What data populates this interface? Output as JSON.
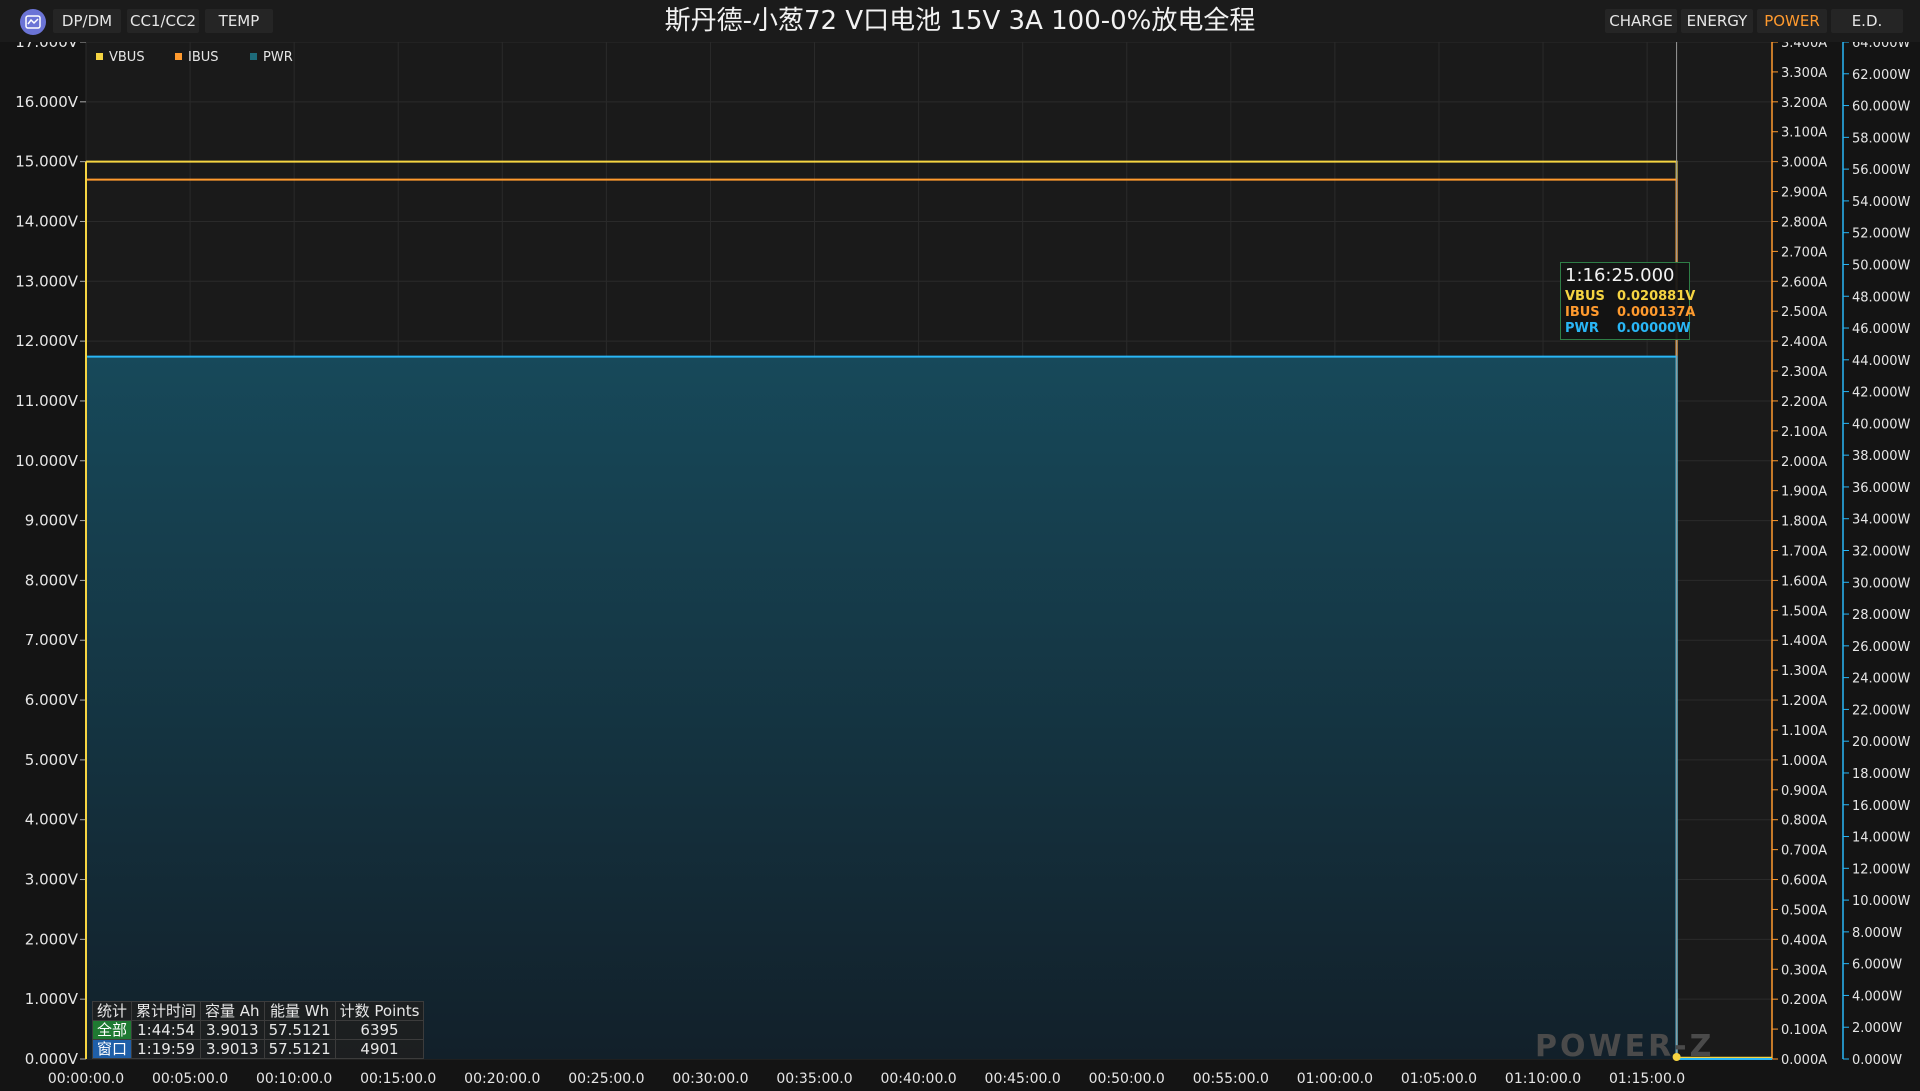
{
  "window": {
    "title": "斯丹德-小葱72 V口电池 15V 3A 100-0%放电全程"
  },
  "toolbar": {
    "left_tabs": [
      "DP/DM",
      "CC1/CC2",
      "TEMP"
    ],
    "mode_buttons": [
      {
        "label": "CHARGE",
        "active": false
      },
      {
        "label": "ENERGY",
        "active": false
      },
      {
        "label": "POWER",
        "active": true
      },
      {
        "label": "E.D.",
        "active": false
      }
    ]
  },
  "legend": [
    {
      "name": "VBUS",
      "color": "#f5d442"
    },
    {
      "name": "IBUS",
      "color": "#ff9a2e"
    },
    {
      "name": "PWR",
      "color": "#1e6b7a"
    }
  ],
  "tooltip": {
    "time": "1:16:25.000",
    "rows": [
      {
        "label": "VBUS",
        "value": "0.020881V",
        "color": "#f5d442"
      },
      {
        "label": "IBUS",
        "value": "0.000137A",
        "color": "#ff9a2e"
      },
      {
        "label": "PWR",
        "value": "0.00000W",
        "color": "#29b6f6"
      }
    ]
  },
  "stats": {
    "headers": [
      "统计",
      "累计时间",
      "容量 Ah",
      "能量 Wh",
      "计数 Points"
    ],
    "rows": [
      [
        "全部",
        "1:44:54",
        "3.9013",
        "57.5121",
        "6395"
      ],
      [
        "窗口",
        "1:19:59",
        "3.9013",
        "57.5121",
        "4901"
      ]
    ]
  },
  "logo_text": "POWER-Z",
  "colors": {
    "vbus": "#f5d442",
    "ibus": "#ff9a2e",
    "pwr_line": "#29b6f6",
    "pwr_fill_top": "#17495a",
    "pwr_fill_bottom": "#12202a",
    "grid": "#2a2a2a",
    "cursor": "#9a9a9a"
  },
  "chart_data": {
    "type": "line",
    "x_ticks": [
      "00:00:00.0",
      "00:05:00.0",
      "00:10:00.0",
      "00:15:00.0",
      "00:20:00.0",
      "00:25:00.0",
      "00:30:00.0",
      "00:35:00.0",
      "00:40:00.0",
      "00:45:00.0",
      "00:50:00.0",
      "00:55:00.0",
      "01:00:00.0",
      "01:05:00.0",
      "01:10:00.0",
      "01:15:00.0"
    ],
    "x_range_seconds": [
      0,
      4860
    ],
    "cursor_time_seconds": 4585,
    "y_left": {
      "label": "VBUS",
      "range": [
        0,
        17
      ],
      "ticks": [
        "0.000V",
        "1.000V",
        "2.000V",
        "3.000V",
        "4.000V",
        "5.000V",
        "6.000V",
        "7.000V",
        "8.000V",
        "9.000V",
        "10.000V",
        "11.000V",
        "12.000V",
        "13.000V",
        "14.000V",
        "15.000V",
        "16.000V",
        "17.000V"
      ]
    },
    "y_right1": {
      "label": "IBUS",
      "range": [
        0,
        3.4
      ],
      "ticks": [
        "0.000A",
        "0.100A",
        "0.200A",
        "0.300A",
        "0.400A",
        "0.500A",
        "0.600A",
        "0.700A",
        "0.800A",
        "0.900A",
        "1.000A",
        "1.100A",
        "1.200A",
        "1.300A",
        "1.400A",
        "1.500A",
        "1.600A",
        "1.700A",
        "1.800A",
        "1.900A",
        "2.000A",
        "2.100A",
        "2.200A",
        "2.300A",
        "2.400A",
        "2.500A",
        "2.600A",
        "2.700A",
        "2.800A",
        "2.900A",
        "3.000A",
        "3.100A",
        "3.200A",
        "3.300A",
        "3.400A"
      ]
    },
    "y_right2": {
      "label": "PWR",
      "range": [
        0,
        64
      ],
      "ticks": [
        "0.000W",
        "2.000W",
        "4.000W",
        "6.000W",
        "8.000W",
        "10.000W",
        "12.000W",
        "14.000W",
        "16.000W",
        "18.000W",
        "20.000W",
        "22.000W",
        "24.000W",
        "26.000W",
        "28.000W",
        "30.000W",
        "32.000W",
        "34.000W",
        "36.000W",
        "38.000W",
        "40.000W",
        "42.000W",
        "44.000W",
        "46.000W",
        "48.000W",
        "50.000W",
        "52.000W",
        "54.000W",
        "56.000W",
        "58.000W",
        "60.000W",
        "62.000W",
        "64.000W"
      ]
    },
    "series": [
      {
        "name": "VBUS",
        "axis": "left",
        "x": [
          0,
          4585,
          4585,
          4860
        ],
        "values": [
          15.0,
          15.0,
          0.02,
          0.02
        ]
      },
      {
        "name": "IBUS",
        "axis": "right1",
        "x": [
          0,
          4585,
          4585,
          4860
        ],
        "values": [
          2.94,
          2.94,
          0.0,
          0.0
        ]
      },
      {
        "name": "PWR",
        "axis": "right2",
        "x": [
          0,
          4585,
          4585,
          4860
        ],
        "values": [
          44.2,
          44.2,
          0.0,
          0.0
        ]
      }
    ],
    "grid": true,
    "legend_position": "top-left"
  }
}
